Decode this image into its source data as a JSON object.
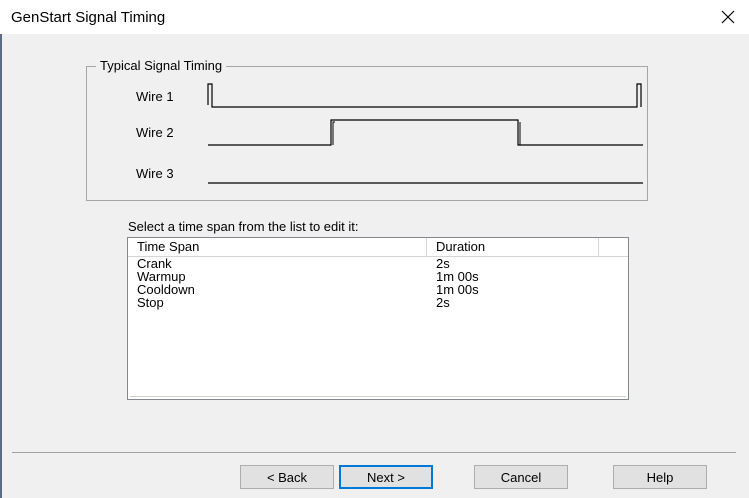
{
  "window": {
    "title": "GenStart Signal Timing"
  },
  "icons": {
    "close": "close-x-icon"
  },
  "group": {
    "legend": "Typical Signal Timing",
    "wires": [
      "Wire 1",
      "Wire 2",
      "Wire 3"
    ]
  },
  "instruction": "Select a time span from the list to edit it:",
  "list": {
    "headers": [
      "Time Span",
      "Duration"
    ],
    "rows": [
      [
        "Crank",
        "2s"
      ],
      [
        "Warmup",
        "1m 00s"
      ],
      [
        "Cooldown",
        "1m 00s"
      ],
      [
        "Stop",
        "2s"
      ]
    ]
  },
  "buttons": {
    "back": "< Back",
    "next": "Next >",
    "cancel": "Cancel",
    "help": "Help"
  }
}
